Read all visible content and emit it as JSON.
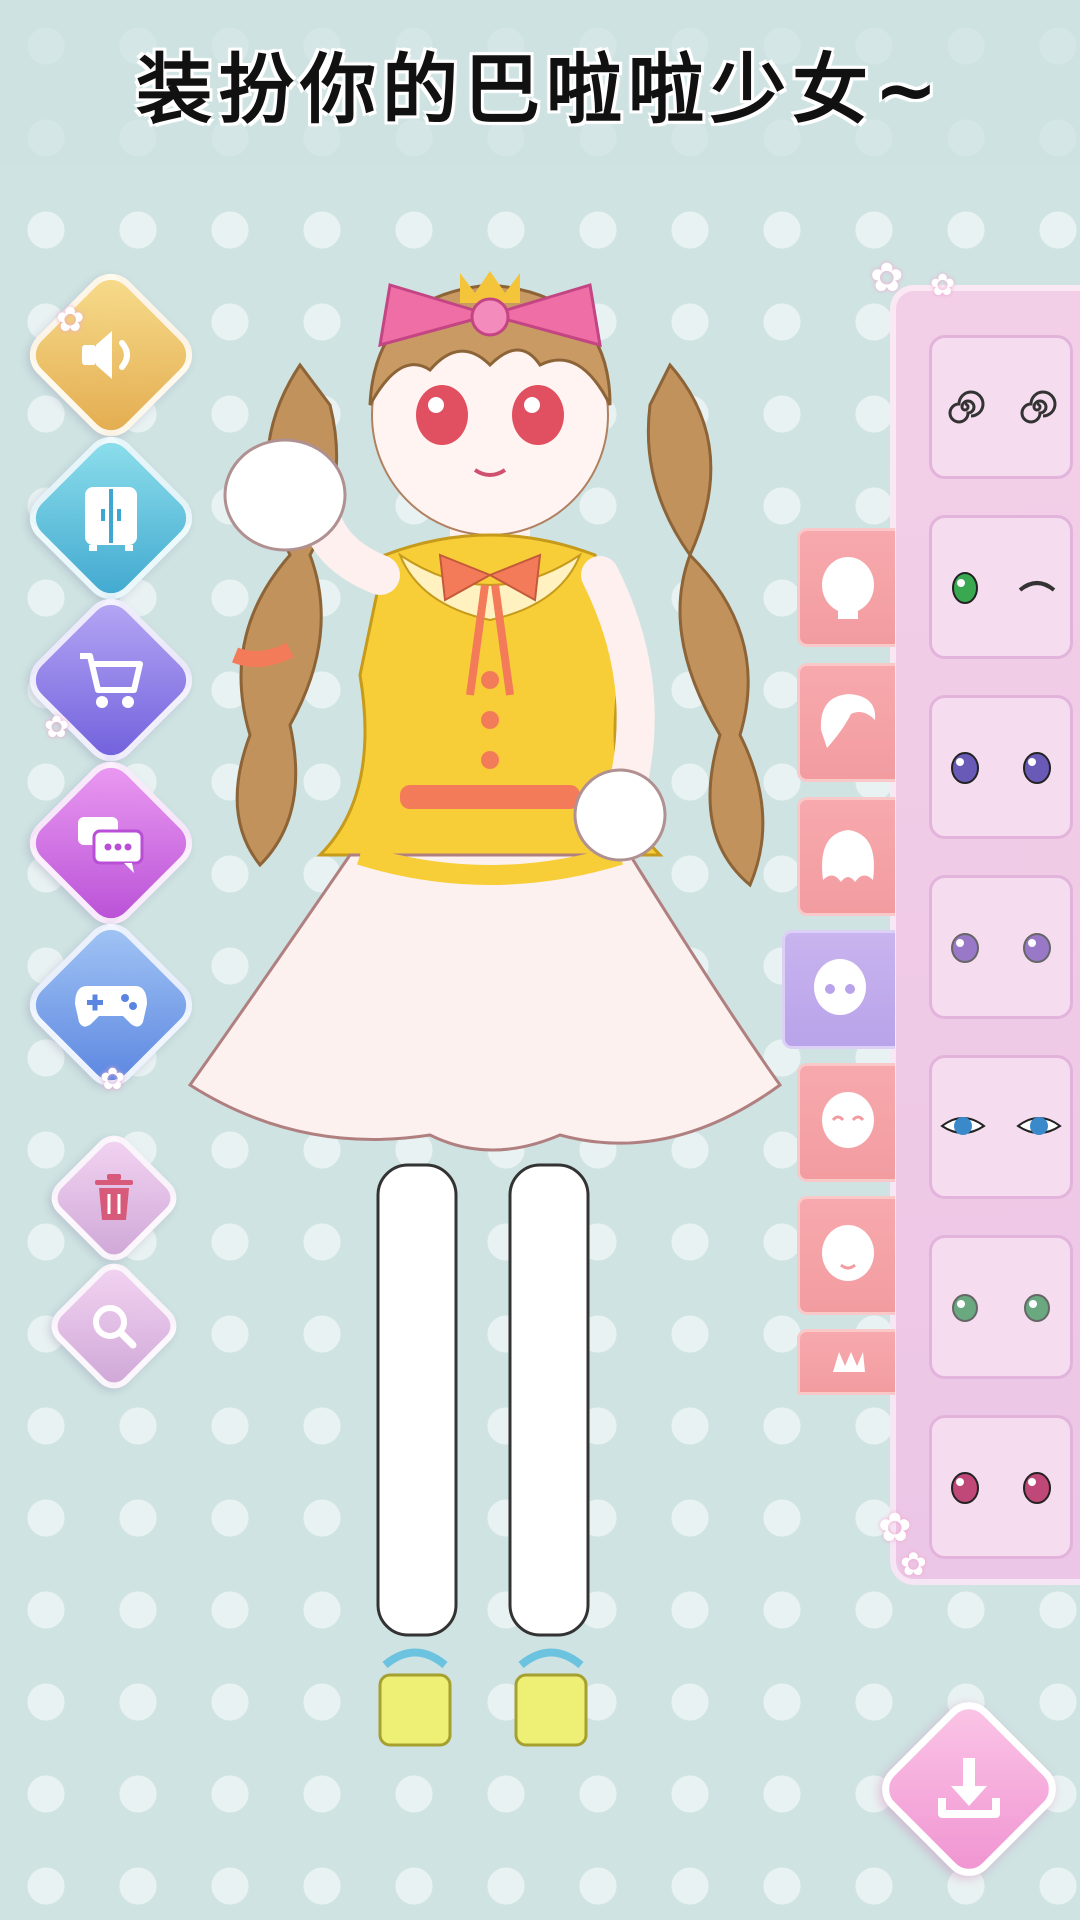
{
  "title": "装扮你的巴啦啦少女~",
  "left_menu": [
    {
      "icon": "speaker-icon",
      "color": "#e7b85a"
    },
    {
      "icon": "wardrobe-icon",
      "color": "#5cc3d9"
    },
    {
      "icon": "shopping-cart-icon",
      "color": "#8a7ae6"
    },
    {
      "icon": "chat-icon",
      "color": "#cf6fe0"
    },
    {
      "icon": "gamepad-icon",
      "color": "#6a9be8"
    },
    {
      "icon": "trash-icon",
      "color": "#c7a3cf"
    },
    {
      "icon": "magnifier-icon",
      "color": "#c7a3cf"
    }
  ],
  "category_tabs": [
    {
      "icon": "face-blank-icon",
      "active": false
    },
    {
      "icon": "hair-front-icon",
      "active": false
    },
    {
      "icon": "hair-back-icon",
      "active": false
    },
    {
      "icon": "eyes-icon",
      "active": true
    },
    {
      "icon": "smile-closed-icon",
      "active": false
    },
    {
      "icon": "mouth-icon",
      "active": false
    },
    {
      "icon": "accessory-icon",
      "active": false
    }
  ],
  "eye_options": [
    {
      "style": "spiral",
      "color": "#333333"
    },
    {
      "style": "wink",
      "color": "#3aa850"
    },
    {
      "style": "round",
      "color": "#6a5ab8"
    },
    {
      "style": "sparkle",
      "color": "#9a78c8"
    },
    {
      "style": "sharp",
      "color": "#3a8acb"
    },
    {
      "style": "soft",
      "color": "#6aa880"
    },
    {
      "style": "round",
      "color": "#c04878"
    }
  ],
  "download_icon": "download-icon"
}
